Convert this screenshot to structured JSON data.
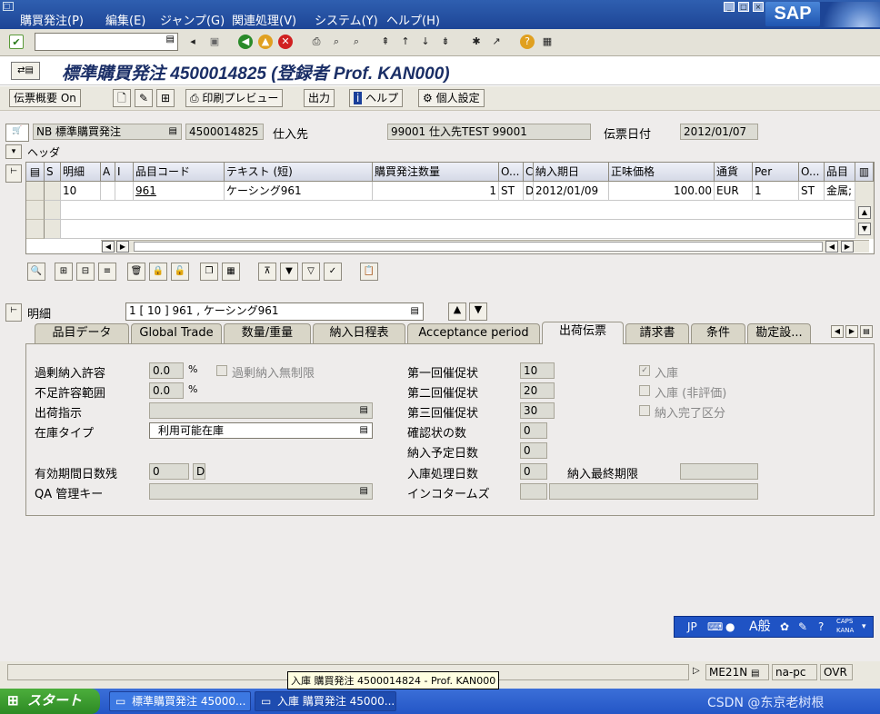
{
  "menu": [
    "購買発注(P)",
    "編集(E)",
    "ジャンプ(G)",
    "関連処理(V)",
    "システム(Y)",
    "ヘルプ(H)"
  ],
  "brand": "SAP",
  "title": "標準購買発注 4500014825 (登録者 Prof. KAN000)",
  "appbar": {
    "doc_overview": "伝票概要 On",
    "print_preview": "印刷プレビュー",
    "output": "出力",
    "help": "ヘルプ",
    "personal": "個人設定"
  },
  "header": {
    "doc_type": "NB 標準購買発注",
    "po_number": "4500014825",
    "vendor_label": "仕入先",
    "vendor_value": "99001 仕入先TEST 99001",
    "doc_date_label": "伝票日付",
    "doc_date_value": "2012/01/07"
  },
  "header_section": "ヘッダ",
  "grid": {
    "columns": [
      "S",
      "明細",
      "A",
      "I",
      "品目コード",
      "テキスト (短)",
      "購買発注数量",
      "O...",
      "C",
      "納入期日",
      "正味価格",
      "通貨",
      "Per",
      "O...",
      "品目"
    ],
    "row": {
      "item": "10",
      "material": "961",
      "text": "ケーシング961",
      "qty": "1",
      "unit": "ST",
      "c": "D",
      "delivery": "2012/01/09",
      "price": "100.00",
      "currency": "EUR",
      "per": "1",
      "ounit": "ST",
      "matgroup": "金属;"
    }
  },
  "detail": {
    "label": "明細",
    "selector": "1 [ 10 ] 961 , ケーシング961"
  },
  "tabs": [
    "品目データ",
    "Global Trade",
    "数量/重量",
    "納入日程表",
    "Acceptance period",
    "出荷伝票",
    "請求書",
    "条件",
    "勘定設..."
  ],
  "form": {
    "over_tol_label": "過剰納入許容",
    "over_tol_value": "0.0",
    "under_tol_label": "不足許容範囲",
    "under_tol_value": "0.0",
    "percent": "%",
    "unlimited_label": "過剰納入無制限",
    "ship_instr_label": "出荷指示",
    "stock_type_label": "在庫タイプ",
    "stock_type_value": "利用可能在庫",
    "shelf_life_label": "有効期間日数残",
    "shelf_life_value": "0",
    "shelf_life_unit": "D",
    "qa_key_label": "QA 管理キー",
    "rem1_label": "第一回催促状",
    "rem1_value": "10",
    "rem2_label": "第二回催促状",
    "rem2_value": "20",
    "rem3_label": "第三回催促状",
    "rem3_value": "30",
    "ack_label": "確認状の数",
    "ack_value": "0",
    "plan_days_label": "納入予定日数",
    "plan_days_value": "0",
    "gr_days_label": "入庫処理日数",
    "gr_days_value": "0",
    "last_date_label": "納入最終期限",
    "incoterms_label": "インコタームズ",
    "gr_label": "入庫",
    "gr_nonval_label": "入庫 (非評価)",
    "del_complete_label": "納入完了区分"
  },
  "langbar": {
    "lang": "JP",
    "mode": "A般",
    "caps": "CAPS",
    "kana": "KANA"
  },
  "status": {
    "tcode": "ME21N",
    "host": "na-pc",
    "mode": "OVR"
  },
  "tooltip": "入庫 購買発注 4500014824 - Prof. KAN000",
  "taskbar": {
    "start": "スタート",
    "task1": "標準購買発注 45000...",
    "task2": "入庫 購買発注 45000..."
  },
  "watermark": "CSDN @东京老树根"
}
